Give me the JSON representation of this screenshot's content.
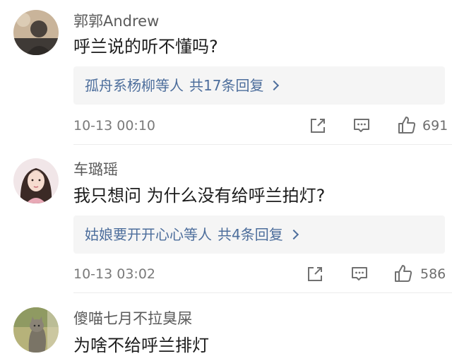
{
  "comments": [
    {
      "username": "郭郭Andrew",
      "text": "呼兰说的听不懂吗?",
      "reply_names": "孤舟系杨柳",
      "reply_suffix": "等人",
      "reply_count": "共17条回复",
      "timestamp": "10-13 00:10",
      "likes": "691"
    },
    {
      "username": "车璐瑶",
      "text": "我只想问 为什么没有给呼兰拍灯?",
      "reply_names": "姑娘要开开心心",
      "reply_suffix": "等人",
      "reply_count": "共4条回复",
      "timestamp": "10-13 03:02",
      "likes": "586"
    },
    {
      "username": "傻喵七月不拉臭屎",
      "text": "为啥不给呼兰排灯"
    }
  ],
  "icons": {
    "share": "share-icon",
    "comment": "comment-icon",
    "like": "thumbs-up-icon",
    "chevron": "chevron-right-icon"
  },
  "colors": {
    "link": "#4d6e9c",
    "reply_bg": "#f5f5f5",
    "meta": "#7a7a7a"
  }
}
